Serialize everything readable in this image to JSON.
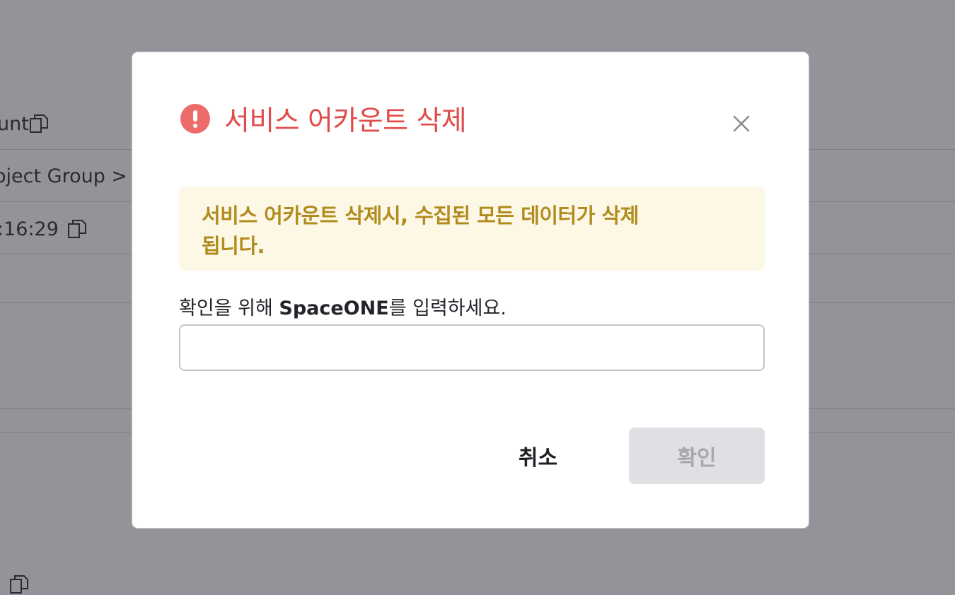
{
  "background": {
    "rows": [
      {
        "text": "unt"
      },
      {
        "text": "oject Group > D"
      },
      {
        "text": ":16:29"
      }
    ]
  },
  "modal": {
    "title": "서비스 어카운트 삭제",
    "warning": "서비스 어카운트 삭제시, 수집된 모든 데이터가 삭제됩니다.",
    "confirm_prefix": "확인을 위해 ",
    "confirm_keyword": "SpaceONE",
    "confirm_suffix": "를 입력하세요.",
    "input_value": "",
    "input_placeholder": "",
    "cancel_label": "취소",
    "ok_label": "확인"
  },
  "icons": {
    "alert": "exclamation-circle-icon",
    "close": "close-icon",
    "copy": "copy-icon"
  },
  "colors": {
    "overlay": "#939499",
    "title": "#e14b4b",
    "alert_icon": "#ee6b6b",
    "warning_bg": "#fcf8e5",
    "warning_text": "#b18b1d",
    "disabled_button_bg": "#dfe0e3"
  }
}
